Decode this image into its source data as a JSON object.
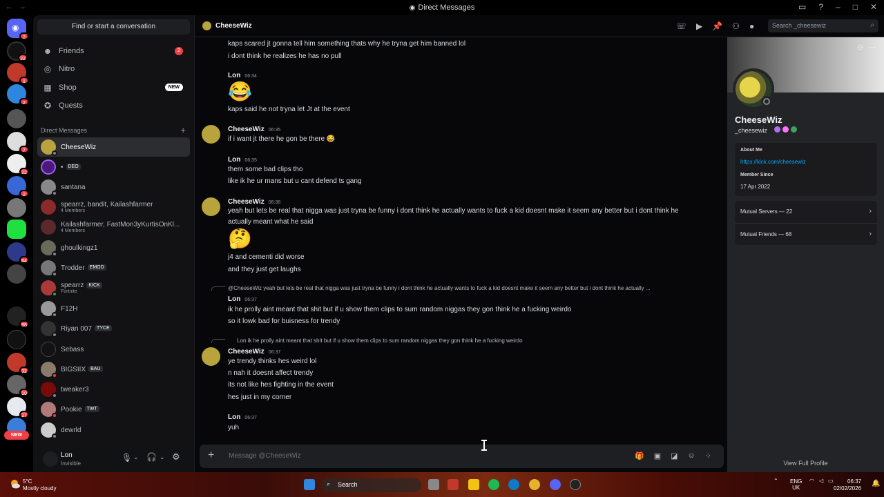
{
  "window": {
    "title": "Direct Messages"
  },
  "guild_badges": {
    "g0": "2",
    "g1": "22",
    "g2": "1",
    "g3": "2",
    "g5": "7",
    "g6": "22",
    "g7": "2",
    "g9": "64",
    "g11": "98",
    "g13": "32",
    "g14": "10",
    "g15": "27",
    "new": "NEW"
  },
  "sidebar": {
    "find_label": "Find or start a conversation",
    "nav": [
      {
        "label": "Friends",
        "badge": "2"
      },
      {
        "label": "Nitro"
      },
      {
        "label": "Shop",
        "tag": "NEW"
      },
      {
        "label": "Quests"
      }
    ],
    "dm_header": "Direct Messages",
    "dms": [
      {
        "name": "CheeseWiz"
      },
      {
        "name": "•",
        "tag": "DEO"
      },
      {
        "name": "santana"
      },
      {
        "name": "spearrz, bandit, Kailashfarmer",
        "sub": "4 Members"
      },
      {
        "name": "Kailashfarmer, FastMon3yKurtisOnKl...",
        "sub": "4 Members"
      },
      {
        "name": "ghoulkingz1"
      },
      {
        "name": "Trodder",
        "tag": "EMOD"
      },
      {
        "name": "spearrz",
        "tag": "KICK",
        "sub": "Fortnite"
      },
      {
        "name": "F12H"
      },
      {
        "name": "Riyan 007",
        "tag": "TYCE"
      },
      {
        "name": "Sebass"
      },
      {
        "name": "BIGSIIX",
        "tag": "BAU"
      },
      {
        "name": "tweaker3"
      },
      {
        "name": "Pookie",
        "tag": "TWT"
      },
      {
        "name": "dewrld"
      }
    ],
    "user": {
      "name": "Lon",
      "status": "Invisible"
    }
  },
  "chat": {
    "header_name": "CheeseWiz",
    "search_placeholder": "Search _cheesewiz",
    "messages": {
      "m0a": "kaps scared jt gonna tell him something thats why he tryna get him banned lol",
      "m0b": "i dont think he realizes he has no pull",
      "a1": "Lon",
      "t1": "06:34",
      "e1": "😂",
      "m1a": "kaps said he not tryna let Jt at the event",
      "a2": "CheeseWiz",
      "t2": "06:35",
      "m2a": "if i want jt there he gon be there 😂",
      "a3": "Lon",
      "t3": "06:35",
      "m3a": "them some bad clips tho",
      "m3b": "like ik he ur mans but u cant defend ts gang",
      "a4": "CheeseWiz",
      "t4": "06:36",
      "m4a": "yeah but lets be real that nigga was just tryna be funny i dont think he actually wants to fuck a kid doesnt make it seem any better but i dont think he",
      "m4b": "actually meant what he said",
      "e4": "🤔",
      "m4c": "j4 and cementi did worse",
      "m4d": "and they just get laughs",
      "r5": "@CheeseWiz yeah but lets be real that nigga was just tryna be funny i dont think he actually wants to fuck a kid doesnt make it seem any better but i dont think he actually ...",
      "a5": "Lon",
      "t5": "06:37",
      "m5a": "ik he prolly aint meant that shit but if u show them clips to sum random niggas they gon think he a fucking weirdo",
      "m5b": "so it lowk bad for buisness for trendy",
      "r6": "Lon ik he prolly aint meant that shit but if u show them clips to sum random niggas they gon think he a fucking weirdo",
      "a6": "CheeseWiz",
      "t6": "06:37",
      "m6a": "ye trendy thinks hes weird lol",
      "m6b": "n nah it doesnt affect trendy",
      "m6c": "its not like hes fighting in the event",
      "m6d": "hes just in my corner",
      "a7": "Lon",
      "t7": "06:37",
      "m7a": "yuh"
    },
    "composer_placeholder": "Message @CheeseWiz"
  },
  "profile": {
    "name": "CheeseWiz",
    "handle": "_cheesewiz",
    "about_label": "About Me",
    "about_link": "https://kick.com/cheesewiz",
    "member_label": "Member Since",
    "member_since": "17 Apr 2022",
    "mutual_servers": "Mutual Servers — 22",
    "mutual_friends": "Mutual Friends — 68",
    "view_full": "View Full Profile"
  },
  "taskbar": {
    "temp": "5°C",
    "weather": "Mostly cloudy",
    "search": "Search",
    "lang1": "ENG",
    "lang2": "UK",
    "time": "06:37",
    "date": "02/02/2026"
  },
  "colors": {
    "accent": "#5865f2",
    "danger": "#f23f43",
    "link": "#00a8fc",
    "online": "#23a55a"
  }
}
